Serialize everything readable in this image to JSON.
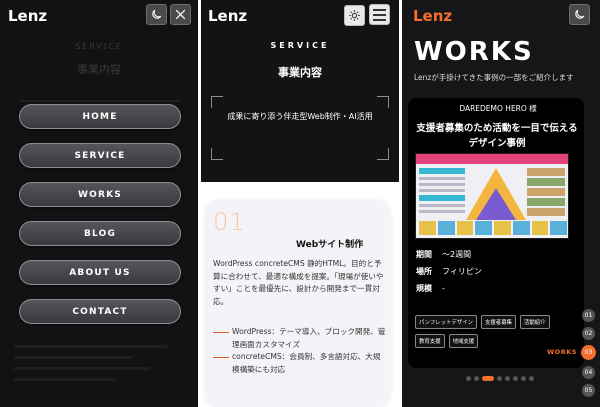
{
  "panel1": {
    "logo": "Lenz",
    "ghost_label": "SERVICE",
    "ghost_title": "事業内容",
    "icons": {
      "theme": "moon-icon",
      "close": "close-icon"
    },
    "menu": [
      "HOME",
      "SERVICE",
      "WORKS",
      "BLOG",
      "ABOUT US",
      "CONTACT"
    ]
  },
  "panel2": {
    "logo": "Lenz",
    "icons": {
      "theme": "sun-icon",
      "menu": "hamburger-icon"
    },
    "section_label": "SERVICE",
    "section_title": "事業内容",
    "section_desc": "成果に寄り添う伴走型Web制作・AI活用",
    "card": {
      "number": "01",
      "title": "Webサイト制作",
      "body": "WordPress concreteCMS 静的HTML。目的と予算に合わせて、最適な構成を提案。「現場が使いやすい」ことを最優先に、設計から開発まで一貫対応。",
      "bullets": [
        "WordPress：テーマ導入、ブロック開発、管理画面カスタマイズ",
        "concreteCMS：会員制、多言語対応、大規模構築にも対応"
      ]
    }
  },
  "panel3": {
    "logo": "Lenz",
    "icons": {
      "theme": "moon-icon"
    },
    "title": "WORKS",
    "subtitle": "Lenzが手掛けてきた事例の一部をご紹介します",
    "work": {
      "client": "DAREDEMO HERO 様",
      "case_title": "支援者募集のため活動を一目で伝えるデザイン事例",
      "meta": [
        {
          "label": "期間",
          "value": "〜2週間"
        },
        {
          "label": "場所",
          "value": "フィリピン"
        },
        {
          "label": "規模",
          "value": "-"
        }
      ],
      "tags": [
        "パンフレットデザイン",
        "支援者募集",
        "活動紹介",
        "教育支援",
        "地域支援"
      ]
    },
    "section_tag": "WORKS",
    "side_nav": [
      "01",
      "02",
      "03",
      "04",
      "05"
    ],
    "side_active": 2,
    "dots_total": 8,
    "dots_active": 2,
    "accent": "#f36f2d"
  }
}
